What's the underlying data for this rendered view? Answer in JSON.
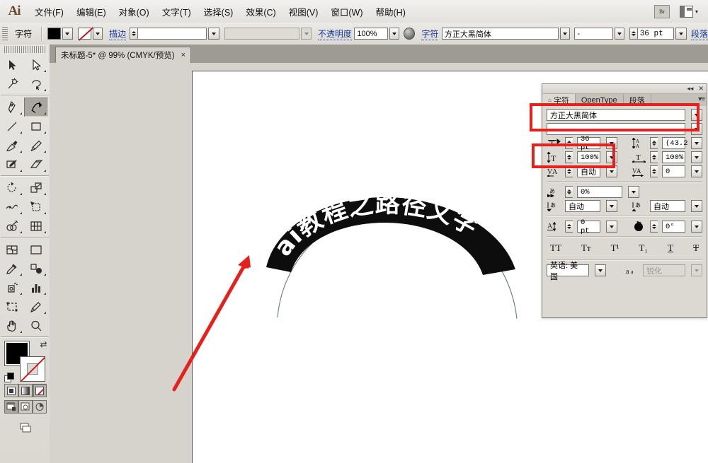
{
  "app": {
    "logo": "Ai"
  },
  "menubar": {
    "items": [
      {
        "label": "文件(F)",
        "name": "menu-file"
      },
      {
        "label": "编辑(E)",
        "name": "menu-edit"
      },
      {
        "label": "对象(O)",
        "name": "menu-object"
      },
      {
        "label": "文字(T)",
        "name": "menu-type"
      },
      {
        "label": "选择(S)",
        "name": "menu-select"
      },
      {
        "label": "效果(C)",
        "name": "menu-effect"
      },
      {
        "label": "视图(V)",
        "name": "menu-view"
      },
      {
        "label": "窗口(W)",
        "name": "menu-window"
      },
      {
        "label": "帮助(H)",
        "name": "menu-help"
      }
    ],
    "bridge_label": "Br",
    "arrange_caret": "▾"
  },
  "control_bar": {
    "context_label": "字符",
    "fill_color": "#000000",
    "stroke_none_color": "#b32121",
    "stroke_label": "描边",
    "stroke_weight": "",
    "stroke_profile": "",
    "opacity_label": "不透明度",
    "opacity_value": "100%",
    "character_label": "字符",
    "font_family": "方正大黑简体",
    "font_style": "-",
    "font_size": "36 pt",
    "paragraph_label": "段落"
  },
  "document_tab": {
    "title": "未标题-5* @ 99% (CMYK/预览)",
    "close": "×"
  },
  "toolbox": {
    "tools": [
      {
        "name": "selection-tool",
        "label": "选择工具",
        "selected": false
      },
      {
        "name": "direct-selection-tool",
        "label": "直接选择工具",
        "selected": false
      },
      {
        "name": "magic-wand-tool",
        "label": "魔棒工具",
        "selected": false
      },
      {
        "name": "lasso-tool",
        "label": "套索工具",
        "selected": false
      },
      {
        "name": "pen-tool",
        "label": "钢笔工具",
        "selected": false
      },
      {
        "name": "type-tool",
        "label": "文字工具",
        "selected": true
      },
      {
        "name": "line-segment-tool",
        "label": "直线段工具",
        "selected": false
      },
      {
        "name": "rectangle-tool",
        "label": "矩形工具",
        "selected": false
      },
      {
        "name": "paintbrush-tool",
        "label": "画笔工具",
        "selected": false
      },
      {
        "name": "pencil-tool",
        "label": "铅笔工具",
        "selected": false
      },
      {
        "name": "blob-brush-tool",
        "label": "斑点画笔工具",
        "selected": false
      },
      {
        "name": "eraser-tool",
        "label": "橡皮擦工具",
        "selected": false
      },
      {
        "name": "rotate-tool",
        "label": "旋转工具",
        "selected": false
      },
      {
        "name": "scale-tool",
        "label": "比例缩放工具",
        "selected": false
      },
      {
        "name": "width-tool",
        "label": "宽度工具",
        "selected": false
      },
      {
        "name": "free-transform-tool",
        "label": "自由变换工具",
        "selected": false
      },
      {
        "name": "shape-builder-tool",
        "label": "形状生成器工具",
        "selected": false
      },
      {
        "name": "column-graph-tool",
        "label": "柱形图工具",
        "selected": false
      },
      {
        "name": "mesh-tool",
        "label": "网格工具",
        "selected": false
      },
      {
        "name": "gradient-tool",
        "label": "渐变工具",
        "selected": false
      },
      {
        "name": "eyedropper-tool",
        "label": "吸管工具",
        "selected": false
      },
      {
        "name": "blend-tool",
        "label": "混合工具",
        "selected": false
      },
      {
        "name": "symbol-sprayer-tool",
        "label": "符号喷枪工具",
        "selected": false
      },
      {
        "name": "bar-graph-tool",
        "label": "图表工具",
        "selected": false
      },
      {
        "name": "artboard-tool",
        "label": "画板工具",
        "selected": false
      },
      {
        "name": "slice-tool",
        "label": "切片工具",
        "selected": false
      },
      {
        "name": "hand-tool",
        "label": "抓手工具",
        "selected": false
      },
      {
        "name": "zoom-tool",
        "label": "缩放工具",
        "selected": false
      }
    ],
    "fill_color": "#000000",
    "stroke_color": "none",
    "swap_icon": "⇄",
    "modes": [
      {
        "name": "fill-color-mode",
        "selected": false
      },
      {
        "name": "gradient-mode",
        "selected": false
      },
      {
        "name": "none-mode",
        "selected": true
      }
    ],
    "screen_modes": [
      {
        "name": "normal-screen-mode",
        "selected": true
      },
      {
        "name": "full-screen-menubar-mode",
        "selected": false
      },
      {
        "name": "full-screen-mode",
        "selected": false
      }
    ]
  },
  "artwork": {
    "path_text": "ai教程之路径文字",
    "text_color": "#ffffff",
    "band_color": "#0d0d0d",
    "path_stroke": "#5f6f72",
    "annotation_arrow_color": "#e8201c"
  },
  "character_panel": {
    "collapse_icon": "◂◂",
    "close_icon": "✕",
    "menu_icon": "▾≡",
    "tabs": [
      {
        "label": "字符",
        "name": "tab-character",
        "active": true
      },
      {
        "label": "OpenType",
        "name": "tab-opentype",
        "active": false
      },
      {
        "label": "段落",
        "name": "tab-paragraph",
        "active": false
      }
    ],
    "font_family": "方正大黑简体",
    "font_style": "-",
    "font_size": "36 pt",
    "leading": "(43.2",
    "vertical_scale": "100%",
    "horizontal_scale": "100%",
    "kerning": "自动",
    "tracking": "0",
    "aki_percent": "0%",
    "tsume_left": "自动",
    "tsume_right": "自动",
    "baseline_shift": "0 pt",
    "character_rotation": "0°",
    "style_buttons": [
      {
        "label": "TT",
        "name": "all-caps-button"
      },
      {
        "label": "Tт",
        "name": "small-caps-button"
      },
      {
        "label": "T¹",
        "name": "superscript-button"
      },
      {
        "label": "T₁",
        "name": "subscript-button"
      },
      {
        "label": "T",
        "name": "underline-button"
      },
      {
        "label": "T",
        "name": "strikethrough-button"
      }
    ],
    "language": "英语: 美国",
    "antialias": "锐化"
  },
  "highlights": {
    "font_box_color": "#e8201c",
    "size_box_color": "#e8201c"
  }
}
